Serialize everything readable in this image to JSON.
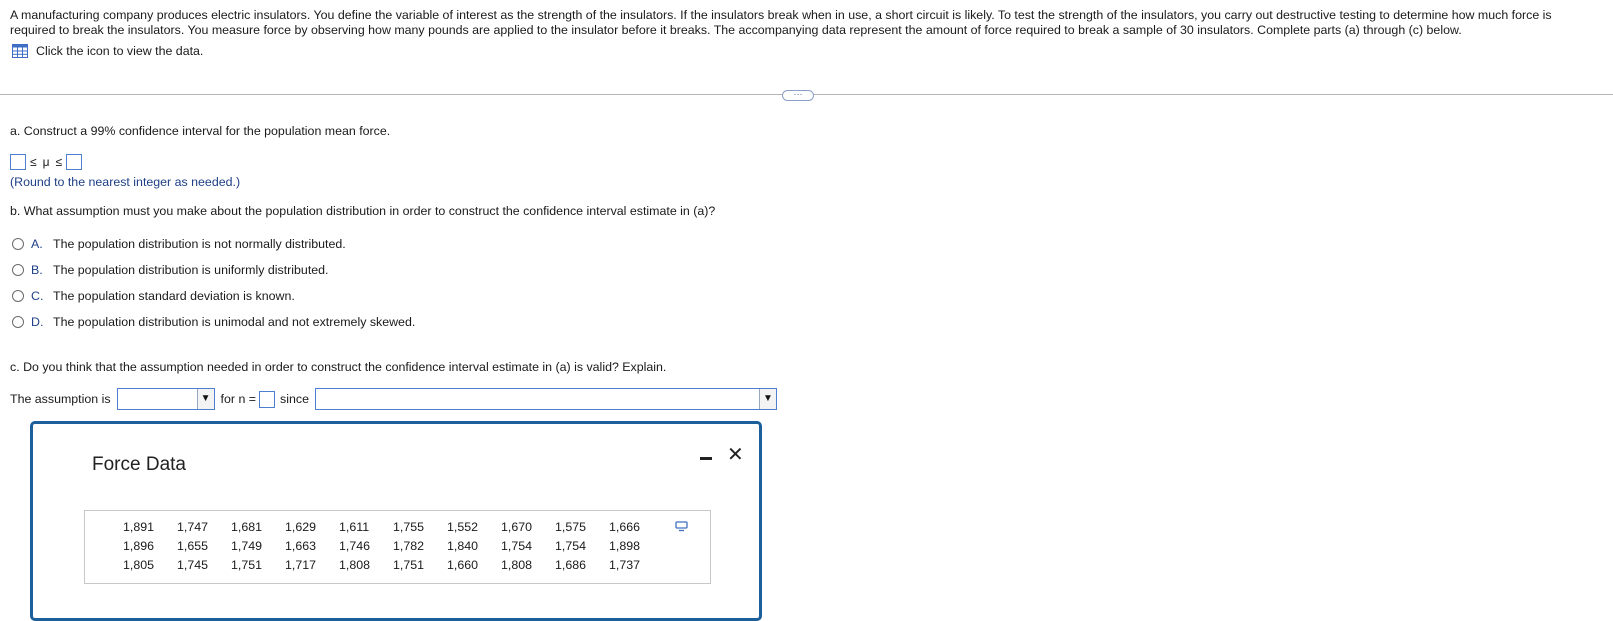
{
  "intro": {
    "text": "A manufacturing company produces electric insulators. You define the variable of interest as the strength of the insulators. If the insulators break when in use, a short circuit is likely. To test the strength of the insulators, you carry out destructive testing to determine how much force is required to break the insulators. You measure force by observing how many pounds are applied to the insulator before it breaks. The accompanying data represent the amount of force required to break a sample of 30 insulators. Complete parts (a) through (c) below.",
    "view_data_label": "Click the icon to view the data.",
    "view_data_icon": "table-grid-icon"
  },
  "more_button": {
    "label": "⋯"
  },
  "part_a": {
    "question": "a. Construct a 99% confidence interval for the population mean force.",
    "le1": "≤",
    "mu": "μ",
    "le2": "≤",
    "round_note": "(Round to the nearest integer as needed.)"
  },
  "part_b": {
    "question": "b. What assumption must you make about the population distribution in order to construct the confidence interval estimate in (a)?",
    "options": [
      {
        "letter": "A.",
        "text": "The population distribution is not normally distributed."
      },
      {
        "letter": "B.",
        "text": "The population distribution is uniformly distributed."
      },
      {
        "letter": "C.",
        "text": "The population standard deviation is known."
      },
      {
        "letter": "D.",
        "text": "The population distribution is unimodal and not extremely skewed."
      }
    ]
  },
  "part_c": {
    "question": "c. Do you think that the assumption needed in order to construct the confidence interval estimate in (a) is valid? Explain.",
    "prefix": "The assumption is",
    "for_n": "for n =",
    "since": "since",
    "assumption_select_value": "",
    "since_select_value": ""
  },
  "modal": {
    "title": "Force Data",
    "rows": [
      [
        "1,891",
        "1,747",
        "1,681",
        "1,629",
        "1,611",
        "1,755",
        "1,552",
        "1,670",
        "1,575",
        "1,666"
      ],
      [
        "1,896",
        "1,655",
        "1,749",
        "1,663",
        "1,746",
        "1,782",
        "1,840",
        "1,754",
        "1,754",
        "1,898"
      ],
      [
        "1,805",
        "1,745",
        "1,751",
        "1,717",
        "1,808",
        "1,751",
        "1,660",
        "1,808",
        "1,686",
        "1,737"
      ]
    ],
    "close_icon": "close-icon",
    "minimize_icon": "minimize-icon",
    "copy_icon": "copy-icon"
  },
  "colors": {
    "accent": "#4d7fd1",
    "link_text": "#1e3f87",
    "modal_border": "#1d5f9a"
  }
}
